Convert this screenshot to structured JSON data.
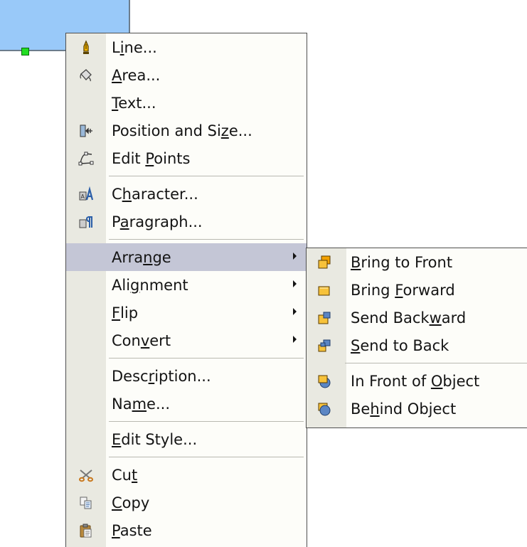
{
  "colors": {
    "menu_bg": "#fdfdf9",
    "icon_column": "#e9e9e1",
    "highlight": "#c4c6d6",
    "shape_fill": "#99c9f9",
    "handle": "#22dd22"
  },
  "main_menu": {
    "items": [
      {
        "name": "line",
        "before": "L",
        "key": "i",
        "after": "ne...",
        "icon": "pen-icon"
      },
      {
        "name": "area",
        "before": "",
        "key": "A",
        "after": "rea...",
        "icon": "paint-bucket-icon"
      },
      {
        "name": "text",
        "before": "",
        "key": "T",
        "after": "ext...",
        "icon": ""
      },
      {
        "name": "position-and-size",
        "before": "Position and Si",
        "key": "z",
        "after": "e...",
        "icon": "position-size-icon"
      },
      {
        "name": "edit-points",
        "before": "Edit ",
        "key": "P",
        "after": "oints",
        "icon": "edit-points-icon"
      },
      {
        "name": "character",
        "before": "C",
        "key": "h",
        "after": "aracter...",
        "icon": "character-icon"
      },
      {
        "name": "paragraph",
        "before": "P",
        "key": "a",
        "after": "ragraph...",
        "icon": "paragraph-icon"
      },
      {
        "name": "arrange",
        "before": "Arra",
        "key": "n",
        "after": "ge",
        "submenu": true
      },
      {
        "name": "alignment",
        "before": "Ali",
        "key": "g",
        "after": "nment",
        "submenu": true
      },
      {
        "name": "flip",
        "before": "",
        "key": "F",
        "after": "lip",
        "submenu": true
      },
      {
        "name": "convert",
        "before": "Con",
        "key": "v",
        "after": "ert",
        "submenu": true
      },
      {
        "name": "description",
        "before": "Desc",
        "key": "r",
        "after": "iption..."
      },
      {
        "name": "name",
        "before": "Na",
        "key": "m",
        "after": "e..."
      },
      {
        "name": "edit-style",
        "before": "",
        "key": "E",
        "after": "dit Style..."
      },
      {
        "name": "cut",
        "before": "Cu",
        "key": "t",
        "after": "",
        "icon": "scissors-icon"
      },
      {
        "name": "copy",
        "before": "",
        "key": "C",
        "after": "opy",
        "icon": "copy-icon"
      },
      {
        "name": "paste",
        "before": "",
        "key": "P",
        "after": "aste",
        "icon": "paste-icon"
      }
    ]
  },
  "arrange_submenu": {
    "items": [
      {
        "name": "bring-to-front",
        "before": "",
        "key": "B",
        "after": "ring to Front",
        "icon": "bring-to-front-icon"
      },
      {
        "name": "bring-forward",
        "before": "Bring ",
        "key": "F",
        "after": "orward",
        "icon": "bring-forward-icon"
      },
      {
        "name": "send-backward",
        "before": "Send Back",
        "key": "w",
        "after": "ard",
        "icon": "send-backward-icon"
      },
      {
        "name": "send-to-back",
        "before": "",
        "key": "S",
        "after": "end to Back",
        "icon": "send-to-back-icon"
      },
      {
        "name": "in-front-of-object",
        "before": "In Front of ",
        "key": "O",
        "after": "bject",
        "icon": "in-front-of-object-icon"
      },
      {
        "name": "behind-object",
        "before": "Be",
        "key": "h",
        "after": "ind Object",
        "icon": "behind-object-icon"
      }
    ]
  }
}
